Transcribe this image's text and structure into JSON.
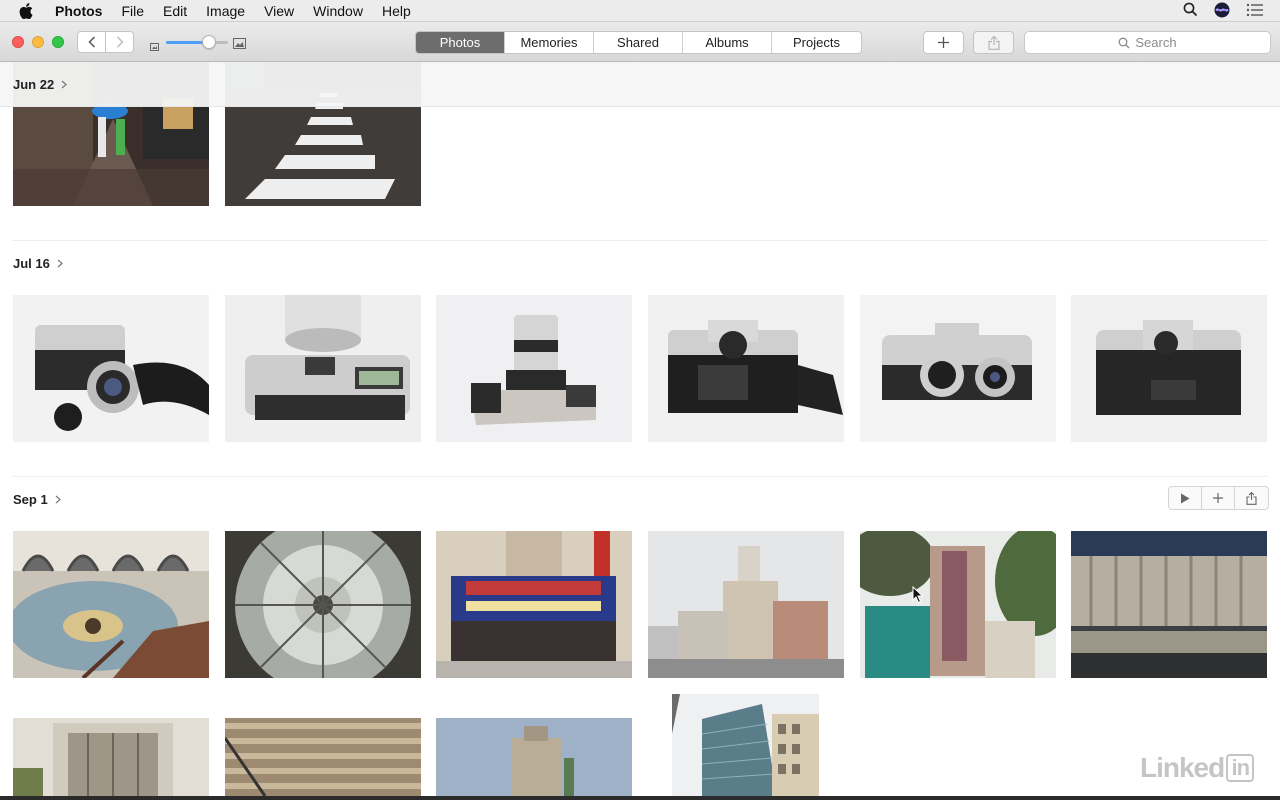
{
  "menubar": {
    "app_name": "Photos",
    "items": [
      "File",
      "Edit",
      "Image",
      "View",
      "Window",
      "Help"
    ]
  },
  "toolbar": {
    "tabs": [
      {
        "label": "Photos",
        "active": true
      },
      {
        "label": "Memories",
        "active": false
      },
      {
        "label": "Shared",
        "active": false
      },
      {
        "label": "Albums",
        "active": false
      },
      {
        "label": "Projects",
        "active": false
      }
    ],
    "zoom_level": 0.7,
    "search_placeholder": "Search"
  },
  "sections": [
    {
      "title": "Jun 22",
      "photo_count_visible": 2
    },
    {
      "title": "Jul 16",
      "photo_count_visible": 6
    },
    {
      "title": "Sep 1",
      "photo_count_visible": 10
    }
  ],
  "watermark": {
    "brand": "Linked",
    "suffix": "in"
  },
  "colors": {
    "accent": "#4c9ff8",
    "active_tab": "#6d6d6d"
  }
}
